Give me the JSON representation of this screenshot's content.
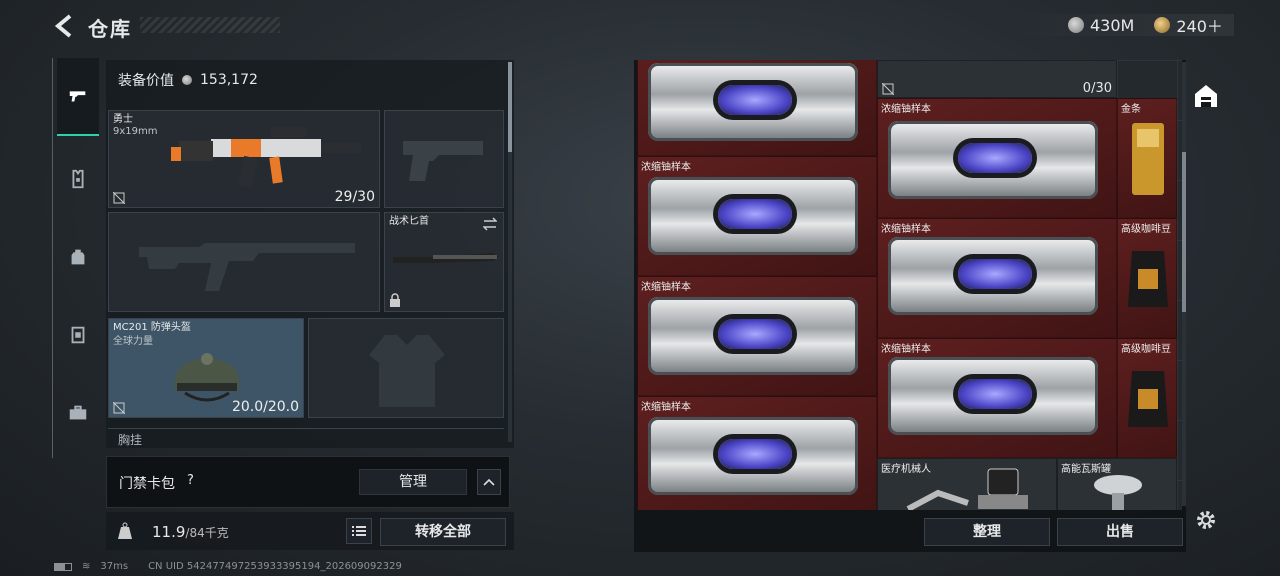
{
  "header": {
    "title": "仓库",
    "currency_silver": "430M",
    "currency_gold": "240＋"
  },
  "equipment": {
    "value_label": "装备价值",
    "value": "153,172",
    "primary_weapon": {
      "name": "勇士",
      "caliber": "9x19mm",
      "ammo": "29/30"
    },
    "melee": {
      "name": "战术匕首"
    },
    "helmet": {
      "name": "MC201 防弹头盔",
      "sub": "全球力量",
      "durability": "20.0/20.0"
    },
    "next_section_label": "胸挂"
  },
  "card_bag": {
    "label": "门禁卡包",
    "help": "?",
    "manage": "管理"
  },
  "weight": {
    "current": "11.9",
    "capacity": "/84千克"
  },
  "actions": {
    "transfer_all": "转移全部",
    "sort": "整理",
    "sell": "出售"
  },
  "status": {
    "ping": "37ms",
    "uid": "CN UID 542477497253933395194_202609092329"
  },
  "storage": {
    "top_counter": "0/30",
    "items": [
      {
        "name": "浓缩铀样本"
      },
      {
        "name": "浓缩铀样本"
      },
      {
        "name": "浓缩铀样本"
      },
      {
        "name": "浓缩铀样本"
      },
      {
        "name": "浓缩铀样本"
      },
      {
        "name": "浓缩铀样本"
      },
      {
        "name": "浓缩铀样本"
      },
      {
        "name": "金条"
      },
      {
        "name": "高级咖啡豆"
      },
      {
        "name": "高级咖啡豆"
      },
      {
        "name": "医疗机械人"
      },
      {
        "name": "高能瓦斯罐"
      }
    ]
  },
  "colors": {
    "accent": "#2fd0b0",
    "rare_red": "#5e1f1f"
  }
}
